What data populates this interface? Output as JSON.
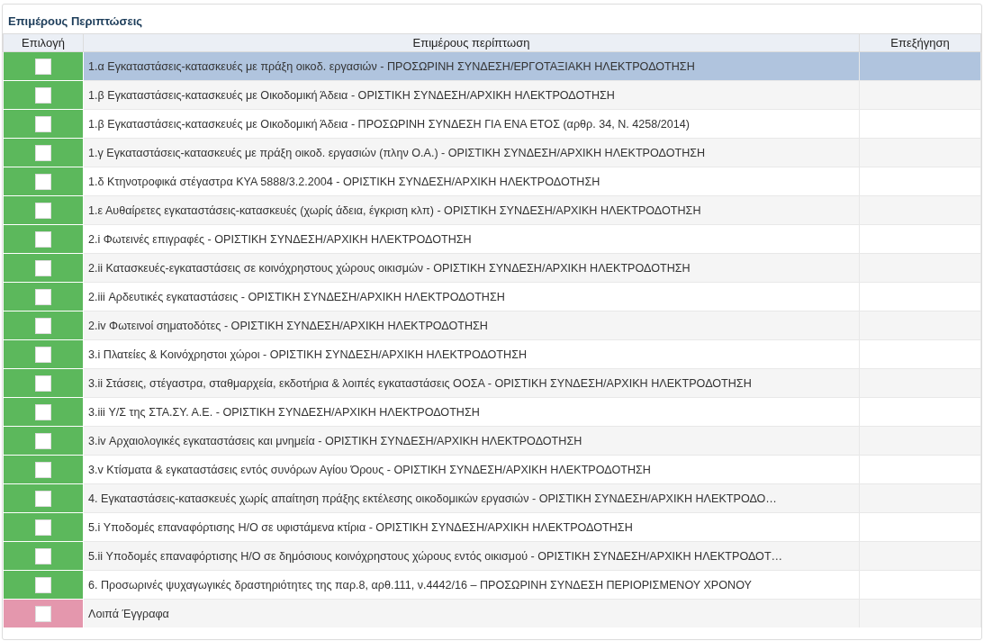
{
  "panel": {
    "title": "Επιμέρους Περιπτώσεις"
  },
  "table": {
    "columns": [
      "Επιλογή",
      "Επιμέρους περίπτωση",
      "Επεξήγηση"
    ],
    "rows": [
      {
        "checked": false,
        "color": "#5cb85c",
        "selected": true,
        "case": "1.α Εγκαταστάσεις-κατασκευές με πράξη οικοδ. εργασιών - ΠΡΟΣΩΡΙΝΗ ΣΥΝΔΕΣΗ/ΕΡΓΟΤΑΞΙΑΚΗ ΗΛΕΚΤΡΟΔΟΤΗΣΗ"
      },
      {
        "checked": false,
        "color": "#5cb85c",
        "selected": false,
        "case": "1.β Εγκαταστάσεις-κατασκευές με Οικοδομική Άδεια - ΟΡΙΣΤΙΚΗ ΣΥΝΔΕΣΗ/ΑΡΧΙΚΗ ΗΛΕΚΤΡΟΔΟΤΗΣΗ"
      },
      {
        "checked": false,
        "color": "#5cb85c",
        "selected": false,
        "case": "1.β Εγκαταστάσεις-κατασκευές με Οικοδομική Άδεια - ΠΡΟΣΩΡΙΝΗ ΣΥΝΔΕΣΗ ΓΙΑ ΕΝΑ ΕΤΟΣ (αρθρ. 34, Ν. 4258/2014)"
      },
      {
        "checked": false,
        "color": "#5cb85c",
        "selected": false,
        "case": "1.γ Εγκαταστάσεις-κατασκευές με πράξη οικοδ. εργασιών (πλην Ο.Α.) - ΟΡΙΣΤΙΚΗ ΣΥΝΔΕΣΗ/ΑΡΧΙΚΗ ΗΛΕΚΤΡΟΔΟΤΗΣΗ"
      },
      {
        "checked": false,
        "color": "#5cb85c",
        "selected": false,
        "case": "1.δ Κτηνοτροφικά στέγαστρα ΚΥΑ 5888/3.2.2004 - ΟΡΙΣΤΙΚΗ ΣΥΝΔΕΣΗ/ΑΡΧΙΚΗ ΗΛΕΚΤΡΟΔΟΤΗΣΗ"
      },
      {
        "checked": false,
        "color": "#5cb85c",
        "selected": false,
        "case": "1.ε Αυθαίρετες εγκαταστάσεις-κατασκευές (χωρίς άδεια, έγκριση κλπ) - ΟΡΙΣΤΙΚΗ ΣΥΝΔΕΣΗ/ΑΡΧΙΚΗ ΗΛΕΚΤΡΟΔΟΤΗΣΗ"
      },
      {
        "checked": false,
        "color": "#5cb85c",
        "selected": false,
        "case": "2.i Φωτεινές επιγραφές - ΟΡΙΣΤΙΚΗ ΣΥΝΔΕΣΗ/ΑΡΧΙΚΗ ΗΛΕΚΤΡΟΔΟΤΗΣΗ"
      },
      {
        "checked": false,
        "color": "#5cb85c",
        "selected": false,
        "case": "2.ii Κατασκευές-εγκαταστάσεις σε κοινόχρηστους χώρους οικισμών - ΟΡΙΣΤΙΚΗ ΣΥΝΔΕΣΗ/ΑΡΧΙΚΗ ΗΛΕΚΤΡΟΔΟΤΗΣΗ"
      },
      {
        "checked": false,
        "color": "#5cb85c",
        "selected": false,
        "case": "2.iii Αρδευτικές εγκαταστάσεις - ΟΡΙΣΤΙΚΗ ΣΥΝΔΕΣΗ/ΑΡΧΙΚΗ ΗΛΕΚΤΡΟΔΟΤΗΣΗ"
      },
      {
        "checked": false,
        "color": "#5cb85c",
        "selected": false,
        "case": "2.iv Φωτεινοί σηματοδότες - ΟΡΙΣΤΙΚΗ ΣΥΝΔΕΣΗ/ΑΡΧΙΚΗ ΗΛΕΚΤΡΟΔΟΤΗΣΗ"
      },
      {
        "checked": false,
        "color": "#5cb85c",
        "selected": false,
        "case": "3.i Πλατείες & Κοινόχρηστοι χώροι - ΟΡΙΣΤΙΚΗ ΣΥΝΔΕΣΗ/ΑΡΧΙΚΗ ΗΛΕΚΤΡΟΔΟΤΗΣΗ"
      },
      {
        "checked": false,
        "color": "#5cb85c",
        "selected": false,
        "case": "3.ii Στάσεις, στέγαστρα, σταθμαρχεία, εκδοτήρια & λοιπές εγκαταστάσεις ΟΟΣΑ - ΟΡΙΣΤΙΚΗ ΣΥΝΔΕΣΗ/ΑΡΧΙΚΗ ΗΛΕΚΤΡΟΔΟΤΗΣΗ"
      },
      {
        "checked": false,
        "color": "#5cb85c",
        "selected": false,
        "case": "3.iii Υ/Σ της ΣΤΑ.ΣΥ. Α.Ε. - ΟΡΙΣΤΙΚΗ ΣΥΝΔΕΣΗ/ΑΡΧΙΚΗ ΗΛΕΚΤΡΟΔΟΤΗΣΗ"
      },
      {
        "checked": false,
        "color": "#5cb85c",
        "selected": false,
        "case": "3.iv Αρχαιολογικές εγκαταστάσεις και μνημεία - ΟΡΙΣΤΙΚΗ ΣΥΝΔΕΣΗ/ΑΡΧΙΚΗ ΗΛΕΚΤΡΟΔΟΤΗΣΗ"
      },
      {
        "checked": false,
        "color": "#5cb85c",
        "selected": false,
        "case": "3.v Κτίσματα & εγκαταστάσεις εντός συνόρων Αγίου Όρους - ΟΡΙΣΤΙΚΗ ΣΥΝΔΕΣΗ/ΑΡΧΙΚΗ ΗΛΕΚΤΡΟΔΟΤΗΣΗ"
      },
      {
        "checked": false,
        "color": "#5cb85c",
        "selected": false,
        "case": "4. Εγκαταστάσεις-κατασκευές χωρίς απαίτηση πράξης εκτέλεσης οικοδομικών εργασιών - ΟΡΙΣΤΙΚΗ ΣΥΝΔΕΣΗ/ΑΡΧΙΚΗ ΗΛΕΚΤΡΟΔΟ…"
      },
      {
        "checked": false,
        "color": "#5cb85c",
        "selected": false,
        "case": "5.i Υποδομές επαναφόρτισης Η/Ο σε υφιστάμενα κτίρια - ΟΡΙΣΤΙΚΗ ΣΥΝΔΕΣΗ/ΑΡΧΙΚΗ ΗΛΕΚΤΡΟΔΟΤΗΣΗ"
      },
      {
        "checked": false,
        "color": "#5cb85c",
        "selected": false,
        "case": "5.ii Υποδομές επαναφόρτισης Η/Ο σε δημόσιους κοινόχρηστους χώρους εντός οικισμού - ΟΡΙΣΤΙΚΗ ΣΥΝΔΕΣΗ/ΑΡΧΙΚΗ ΗΛΕΚΤΡΟΔΟΤ…"
      },
      {
        "checked": false,
        "color": "#5cb85c",
        "selected": false,
        "case": "6. Προσωρινές ψυχαγωγικές δραστηριότητες της παρ.8, αρθ.111, ν.4442/16 – ΠΡΟΣΩΡΙΝΗ ΣΥΝΔΕΣΗ ΠΕΡΙΟΡΙΣΜΕΝΟΥ ΧΡΟΝΟΥ"
      },
      {
        "checked": false,
        "color": "#e497ad",
        "selected": false,
        "case": "Λοιπά Έγγραφα"
      }
    ]
  }
}
